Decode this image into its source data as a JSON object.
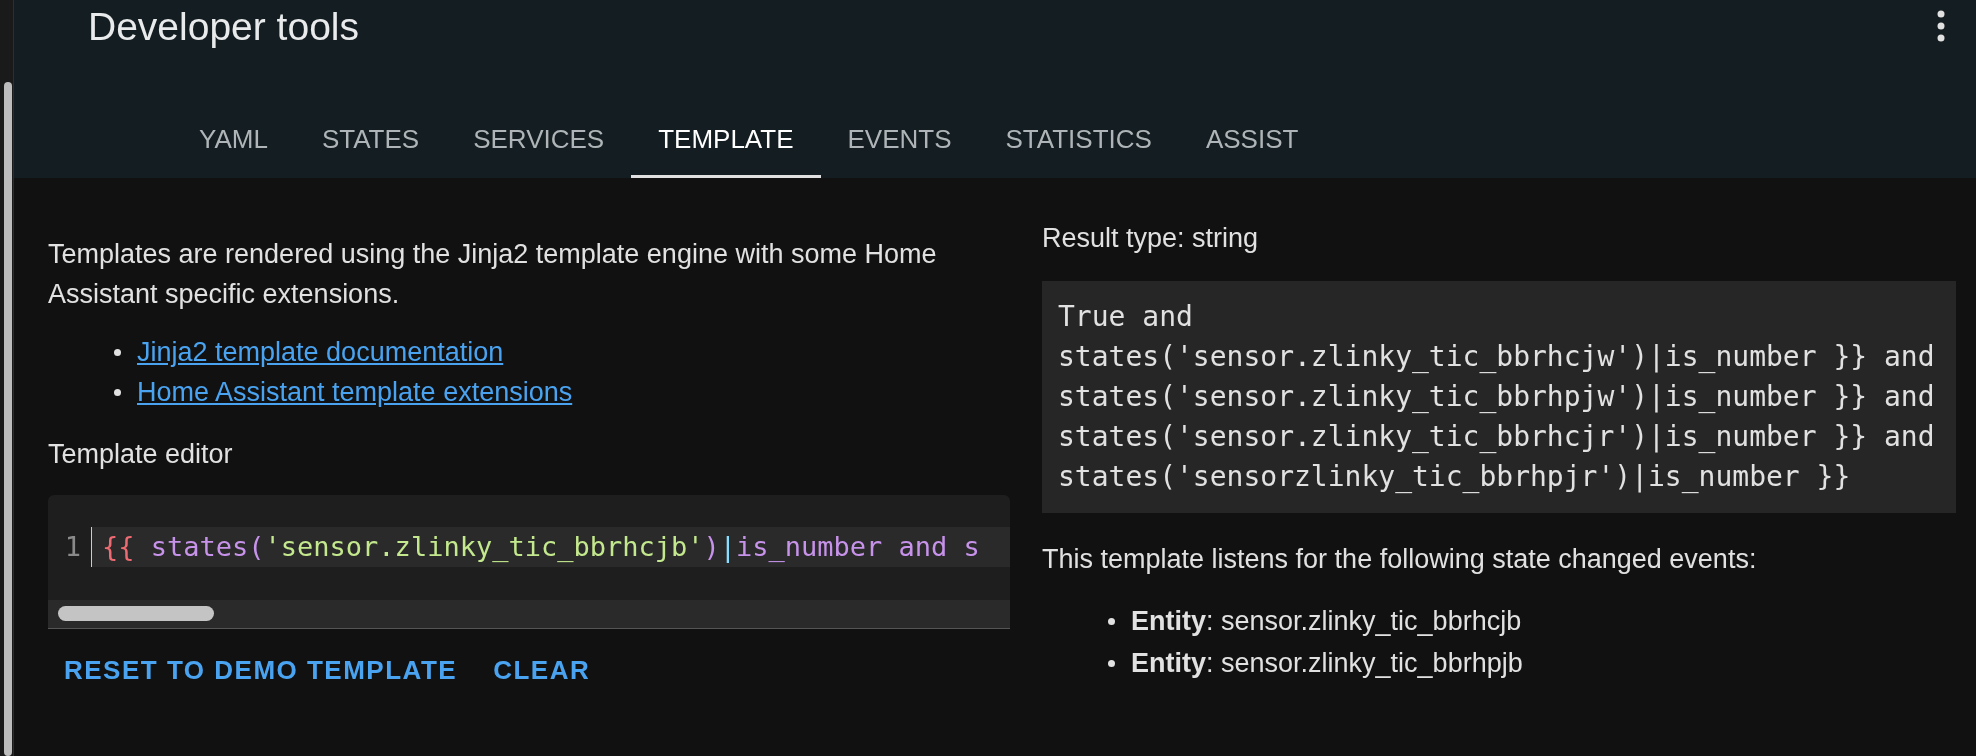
{
  "header": {
    "title": "Developer tools"
  },
  "tabs": [
    {
      "label": "YAML",
      "selected": false
    },
    {
      "label": "STATES",
      "selected": false
    },
    {
      "label": "SERVICES",
      "selected": false
    },
    {
      "label": "TEMPLATE",
      "selected": true
    },
    {
      "label": "EVENTS",
      "selected": false
    },
    {
      "label": "STATISTICS",
      "selected": false
    },
    {
      "label": "ASSIST",
      "selected": false
    }
  ],
  "intro": "Templates are rendered using the Jinja2 template engine with some Home Assistant specific extensions.",
  "links": [
    "Jinja2 template documentation",
    "Home Assistant template extensions"
  ],
  "editor": {
    "label": "Template editor",
    "lines": [
      {
        "number": "1",
        "tokens": [
          {
            "kind": "brace",
            "text": "{{ "
          },
          {
            "kind": "function",
            "text": "states("
          },
          {
            "kind": "string",
            "text": "'sensor.zlinky_tic_bbrhcjb'"
          },
          {
            "kind": "function",
            "text": ")"
          },
          {
            "kind": "operator",
            "text": "|"
          },
          {
            "kind": "function",
            "text": "is_number and s"
          }
        ]
      }
    ]
  },
  "buttons": [
    "RESET TO DEMO TEMPLATE",
    "CLEAR"
  ],
  "result": {
    "type_label": "Result type: string",
    "output_lines": [
      "True and",
      "states('sensor.zlinky_tic_bbrhcjw')|is_number }} and",
      "states('sensor.zlinky_tic_bbrhpjw')|is_number }} and",
      "states('sensor.zlinky_tic_bbrhcjr')|is_number }} and",
      "states('sensorzlinky_tic_bbrhpjr')|is_number }}"
    ],
    "listens_text": "This template listens for the following state changed events:",
    "entities": [
      "**Entity**: sensor.zlinky_tic_bbrhcjb",
      "**Entity**: sensor.zlinky_tic_bbrhpjb"
    ]
  }
}
